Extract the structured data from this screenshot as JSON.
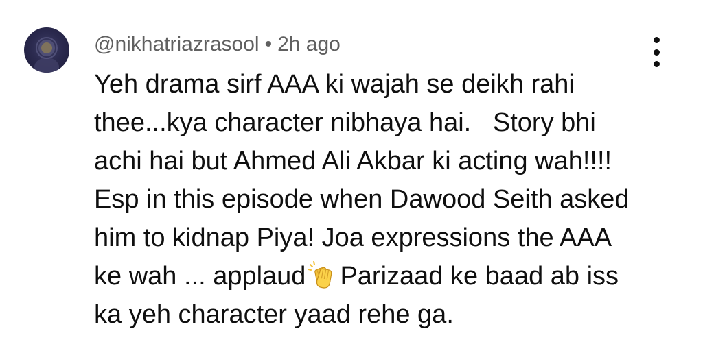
{
  "comment": {
    "author": "@nikhatriazrasool",
    "separator": "•",
    "timestamp": "2h ago",
    "lines": [
      "Yeh drama sirf AAA ki wajah se deikh rahi",
      "thee...kya character nibhaya hai.   Story bhi",
      "achi hai but Ahmed Ali Akbar ki acting wah!!!!",
      "Esp in this episode when Dawood Seith asked",
      "him to kidnap Piya! Joa expressions the AAA"
    ],
    "line6_before": "ke wah ... applaud",
    "line6_emoji": "clapping-hands-icon",
    "line6_after": "Parizaad ke baad ab iss",
    "line7": "ka yeh character yaad rehe ga."
  },
  "menu": {
    "icon": "more-vertical-icon"
  },
  "colors": {
    "meta": "#606060",
    "text": "#0f0f0f",
    "avatar_bg": "#2b2a4f"
  }
}
